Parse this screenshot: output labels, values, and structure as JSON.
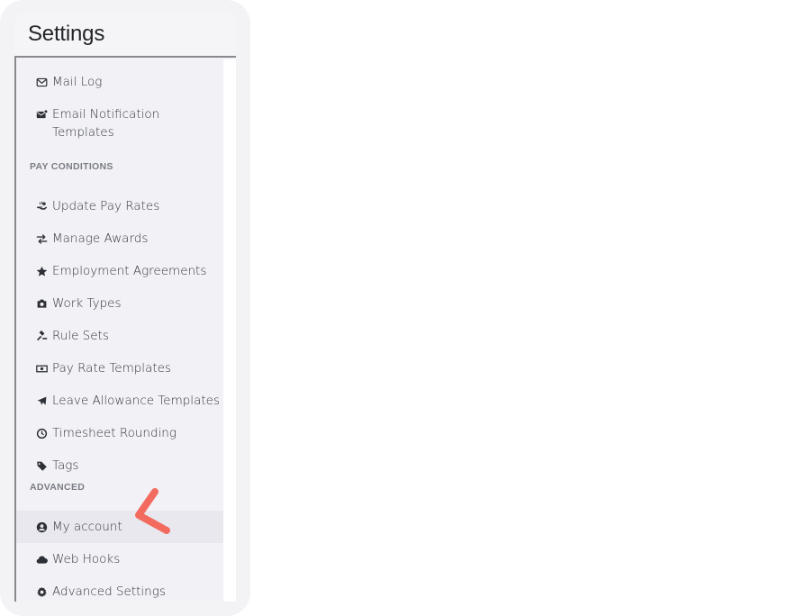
{
  "panel": {
    "title": "Settings"
  },
  "items_top": [
    {
      "label": "Mail Log",
      "icon": "envelope-icon"
    },
    {
      "label": "Email Notification Templates",
      "icon": "email-notification-icon"
    }
  ],
  "sections": [
    {
      "header": "PAY CONDITIONS",
      "items": [
        {
          "label": "Update Pay Rates",
          "icon": "hand-money-icon"
        },
        {
          "label": "Manage Awards",
          "icon": "exchange-arrows-icon"
        },
        {
          "label": "Employment Agreements",
          "icon": "star-icon"
        },
        {
          "label": "Work Types",
          "icon": "camera-icon"
        },
        {
          "label": "Rule Sets",
          "icon": "gavel-icon"
        },
        {
          "label": "Pay Rate Templates",
          "icon": "banknote-icon"
        },
        {
          "label": "Leave Allowance Templates",
          "icon": "plane-icon"
        },
        {
          "label": "Timesheet Rounding",
          "icon": "clock-icon"
        },
        {
          "label": "Tags",
          "icon": "tag-icon"
        }
      ]
    },
    {
      "header": "ADVANCED",
      "items": [
        {
          "label": "My account",
          "icon": "user-circle-icon",
          "active": true
        },
        {
          "label": "Web Hooks",
          "icon": "cloud-icon"
        },
        {
          "label": "Advanced Settings",
          "icon": "gear-icon"
        }
      ]
    }
  ],
  "colors": {
    "pointer": "#f26b5e",
    "active_bg": "#e8e8ee",
    "panel_bg": "#f1f1f6"
  }
}
